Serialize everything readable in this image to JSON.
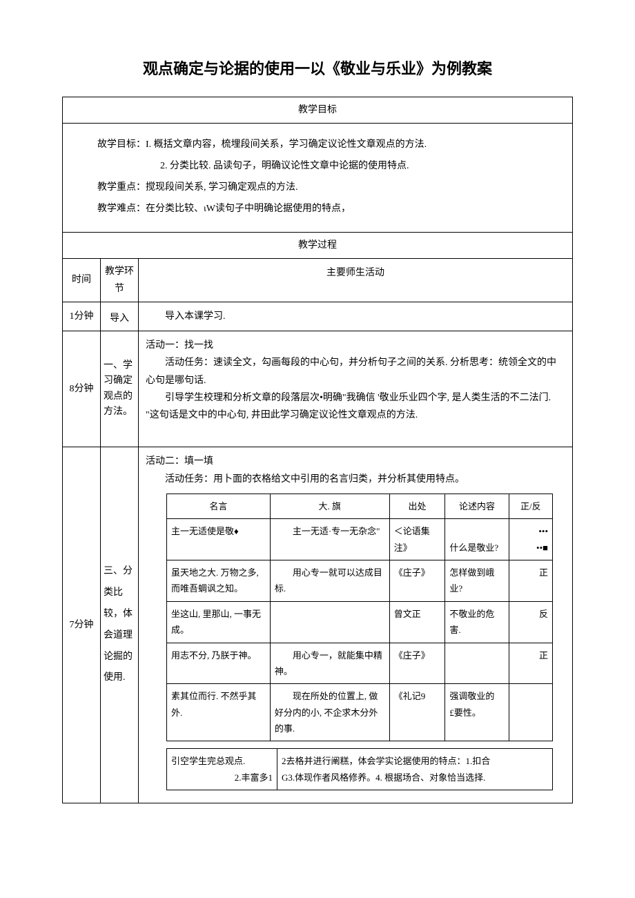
{
  "title": "观点确定与论据的使用一以《敬业与乐业》为例教案",
  "section_goals_header": "教学目标",
  "goals": {
    "line1": "故学目标：I. 概括文章内容，梳埋段间关系，学习确定议论性文章观点的方法.",
    "line2": "2. 分类比较. 品读句子，明确议论性文章中论据的使用特点.",
    "line3": "教学重点：搅现段间关系, 学习确定观点的方法.",
    "line4": "教学难点：在分类比较、ιW读句子中明确论据使用的特点，"
  },
  "section_process_header": "教学过程",
  "proc_headers": {
    "time": "时间",
    "stage": "教学环节",
    "activity": "主要师生活动"
  },
  "rows": [
    {
      "time": "1分钟",
      "stage": "导入",
      "activity_lines": [
        "导入本课学习."
      ]
    },
    {
      "time": "8分钟",
      "stage": "一、学习确定观点的方法。",
      "activity_lines": [
        "活动一：找一找",
        "　　活动任务：速读全文，勾画每段的中心句，并分析句子之间的关系. 分析思考：统领全文的中心句是哪句话.",
        "　　引导学生校理和分析文章的段落层次•明确\"我确信 '敬业乐业四个字, 是人类生活的不二法门. \"这句话是文中的中心句, 井田此学习确定议论性文章观点的方法."
      ]
    }
  ],
  "row3": {
    "time": "7分钟",
    "stage": "三、分类比较，体会道理论掘的使用.",
    "intro1": "活动二：填一填",
    "intro2": "活动任务：用卜面的衣格给文中引用的名言归类，并分析其使用特点。"
  },
  "inner_headers": {
    "quote": "名言",
    "meaning": "大. 旗",
    "source": "出处",
    "content": "论述内容",
    "pf": "正/反"
  },
  "inner_rows": [
    {
      "quote": "主一无适使是敬♦",
      "meaning": "主一无适·专一无杂念\"",
      "source": "＜论语集注》",
      "content": "什么是敬业?",
      "pf": "•••\n••■"
    },
    {
      "quote": "虽天地之大. 万物之多, 而唯吾蜩讽之知。",
      "meaning": "用心专一就可以达成目标.",
      "source": "《庄子》",
      "content": "怎样做到峨业?",
      "pf": "正"
    },
    {
      "quote": "坐这山, 里那山, 一事无成。",
      "meaning": "",
      "source": "曾文正",
      "content": "不敬业的危害.",
      "pf": "反"
    },
    {
      "quote": "用志不分, 乃朕于神。",
      "meaning": "用心专一，就能集中精神。",
      "source": "《庄子》",
      "content": "",
      "pf": "正"
    },
    {
      "quote": "素其位而行. 不然乎其外.",
      "meaning": "现在所处的位置上, 做好分内的小, 不企求木分外的事.",
      "source": "《礼记9",
      "content": "强调敬业的£要性。",
      "pf": ""
    }
  ],
  "summary": {
    "left1": "引空学生完总观点.",
    "left2": "2.丰富多1",
    "right1": "2去格并进行阐糕，体会学实论据使用的特点：1.扣合",
    "right2": "G3.体现作者风格修养。4. 根据场合、对象恰当选择."
  }
}
